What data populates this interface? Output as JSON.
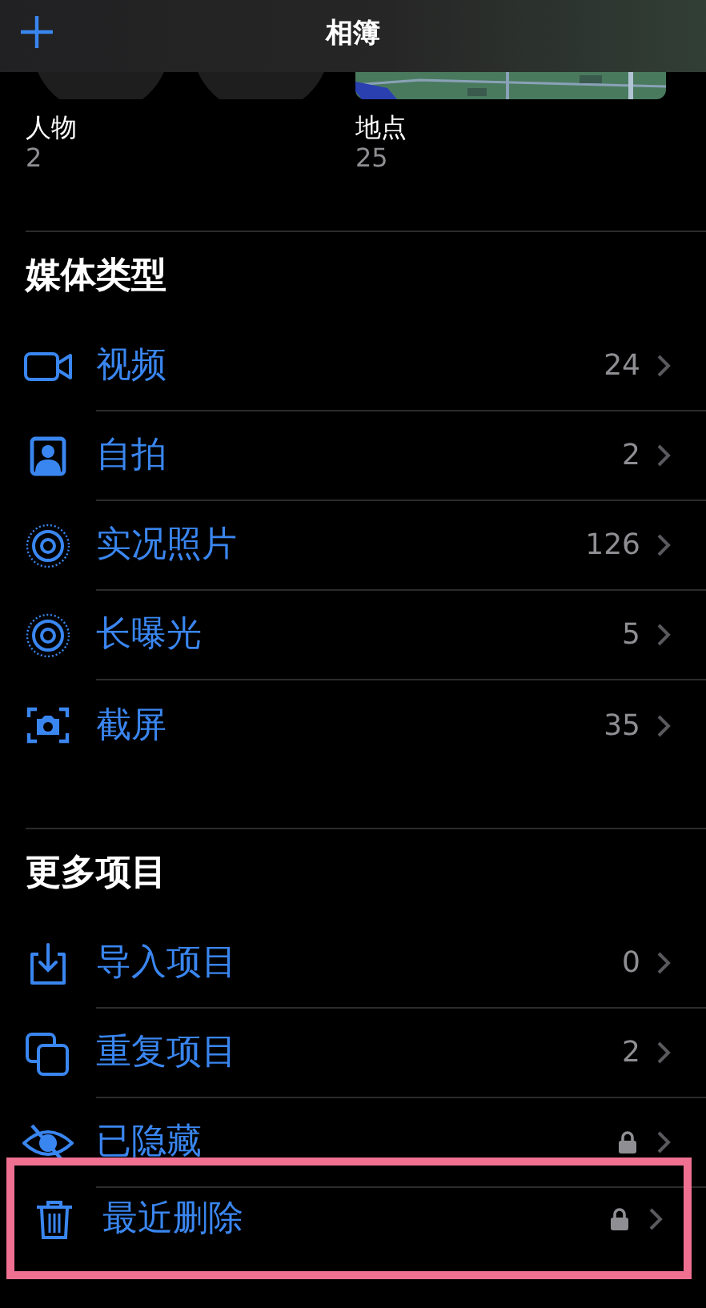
{
  "header": {
    "title": "相簿"
  },
  "collections": [
    {
      "label": "人物",
      "count": "2"
    },
    {
      "label": "地点",
      "count": "25"
    }
  ],
  "sections": [
    {
      "title": "媒体类型",
      "items": [
        {
          "kind": "video",
          "label": "视频",
          "count": "24",
          "locked": false,
          "highlighted": false
        },
        {
          "kind": "selfie",
          "label": "自拍",
          "count": "2",
          "locked": false,
          "highlighted": false
        },
        {
          "kind": "live",
          "label": "实况照片",
          "count": "126",
          "locked": false,
          "highlighted": false
        },
        {
          "kind": "live",
          "label": "长曝光",
          "count": "5",
          "locked": false,
          "highlighted": false
        },
        {
          "kind": "screenshot",
          "label": "截屏",
          "count": "35",
          "locked": false,
          "highlighted": false
        }
      ]
    },
    {
      "title": "更多项目",
      "items": [
        {
          "kind": "import",
          "label": "导入项目",
          "count": "0",
          "locked": false,
          "highlighted": false
        },
        {
          "kind": "duplicate",
          "label": "重复项目",
          "count": "2",
          "locked": false,
          "highlighted": false
        },
        {
          "kind": "hidden",
          "label": "已隐藏",
          "locked": true,
          "highlighted": false
        },
        {
          "kind": "trash",
          "label": "最近删除",
          "locked": true,
          "highlighted": true
        }
      ]
    }
  ]
}
